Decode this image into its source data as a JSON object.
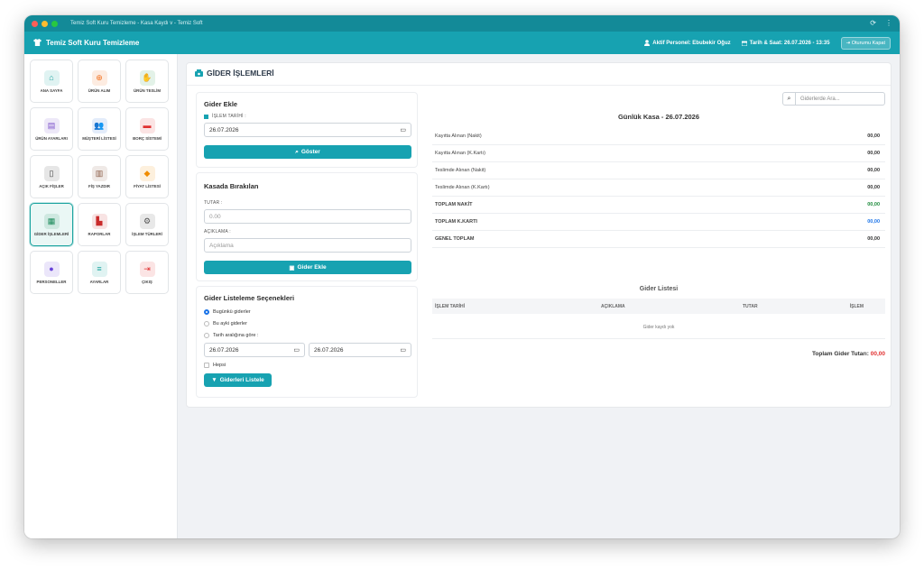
{
  "window": {
    "title": "Temiz Soft Kuru Temizleme - Kasa Kaydı v - Temiz Soft"
  },
  "appbar": {
    "brand": "Temiz Soft Kuru Temizleme",
    "personnel": "Aktif Personel: Ebubekir Oğuz",
    "datetime": "Tarih & Saat: 26.07.2026 - 13:35",
    "logout": "Oturumu Kapat"
  },
  "sidebar": {
    "items": [
      {
        "label": "ANA SAYFA",
        "icon": "home-icon",
        "color": "#1aa39f"
      },
      {
        "label": "ÜRÜN ALIM",
        "icon": "plus-circle-icon",
        "color": "#f2701d"
      },
      {
        "label": "ÜRÜN TESLİM",
        "icon": "hand-icon",
        "color": "#2e9e4f"
      },
      {
        "label": "ÜRÜN AYARLARI",
        "icon": "box-icon",
        "color": "#7b4fc9"
      },
      {
        "label": "MÜŞTERİ LİSTESİ",
        "icon": "users-icon",
        "color": "#2f6fd6"
      },
      {
        "label": "BORÇ SİSTEMİ",
        "icon": "wallet-icon",
        "color": "#e03131"
      },
      {
        "label": "AÇIK FİŞLER",
        "icon": "file-icon",
        "color": "#444444"
      },
      {
        "label": "FİŞ YAZDIR",
        "icon": "barcode-icon",
        "color": "#8a5a44"
      },
      {
        "label": "FİYAT LİSTESİ",
        "icon": "tag-icon",
        "color": "#f08c00"
      },
      {
        "label": "GİDER İŞLEMLERİ",
        "icon": "money-icon",
        "color": "#1b8a5a"
      },
      {
        "label": "RAPORLAR",
        "icon": "chart-icon",
        "color": "#c92a2a"
      },
      {
        "label": "İŞLEM TÜRLERİ",
        "icon": "gears-icon",
        "color": "#555555"
      },
      {
        "label": "PERSONELLER",
        "icon": "user-icon",
        "color": "#6741d9"
      },
      {
        "label": "AYARLAR",
        "icon": "sliders-icon",
        "color": "#1aa39f"
      },
      {
        "label": "ÇIKIŞ",
        "icon": "exit-icon",
        "color": "#e03131"
      }
    ]
  },
  "main": {
    "title": "GİDER İŞLEMLERİ",
    "add_card": {
      "title": "Gider Ekle",
      "date_label": "İŞLEM TARİHİ :",
      "date_value": "26.07.2026",
      "show_button": "Göster"
    },
    "cash_card": {
      "title": "Kasada Bırakılan",
      "amount_label": "TUTAR :",
      "amount_placeholder": "0.00",
      "desc_label": "AÇIKLAMA :",
      "desc_placeholder": "Açıklama",
      "add_button": "Gider Ekle"
    },
    "list_options": {
      "title": "Gider Listeleme Seçenekleri",
      "opt_today": "Bugünkü giderler",
      "opt_month": "Bu ayki giderler",
      "opt_range": "Tarih aralığına göre :",
      "date_from": "26.07.2026",
      "date_to": "26.07.2026",
      "all_label": "Hepsi",
      "list_button": "Giderleri Listele"
    },
    "search_placeholder": "Giderlerde Ara...",
    "kasa": {
      "title": "Günlük Kasa - 26.07.2026",
      "rows": [
        {
          "label": "Kayıtta Alınan (Nakit)",
          "value": "00,00",
          "color": "#333333",
          "bold": false
        },
        {
          "label": "Kayıtta Alınan (K.Kartı)",
          "value": "00,00",
          "color": "#333333",
          "bold": false
        },
        {
          "label": "Teslimde Alınan (Nakit)",
          "value": "00,00",
          "color": "#333333",
          "bold": false
        },
        {
          "label": "Teslimde Alınan (K.Kartı)",
          "value": "00,00",
          "color": "#333333",
          "bold": false
        },
        {
          "label": "TOPLAM NAKİT",
          "value": "00,00",
          "color": "#1b8a3a",
          "bold": true
        },
        {
          "label": "TOPLAM K.KARTI",
          "value": "00,00",
          "color": "#1a73e8",
          "bold": true
        },
        {
          "label": "GENEL TOPLAM",
          "value": "00,00",
          "color": "#333333",
          "bold": true
        }
      ]
    },
    "expense_list": {
      "title": "Gider Listesi",
      "columns": [
        "İŞLEM TARİHİ",
        "AÇIKLAMA",
        "TUTAR",
        "İŞLEM"
      ],
      "empty": "Gider kaydı yok",
      "total_label": "Toplam Gider Tutarı:",
      "total_value": "00,00"
    }
  }
}
